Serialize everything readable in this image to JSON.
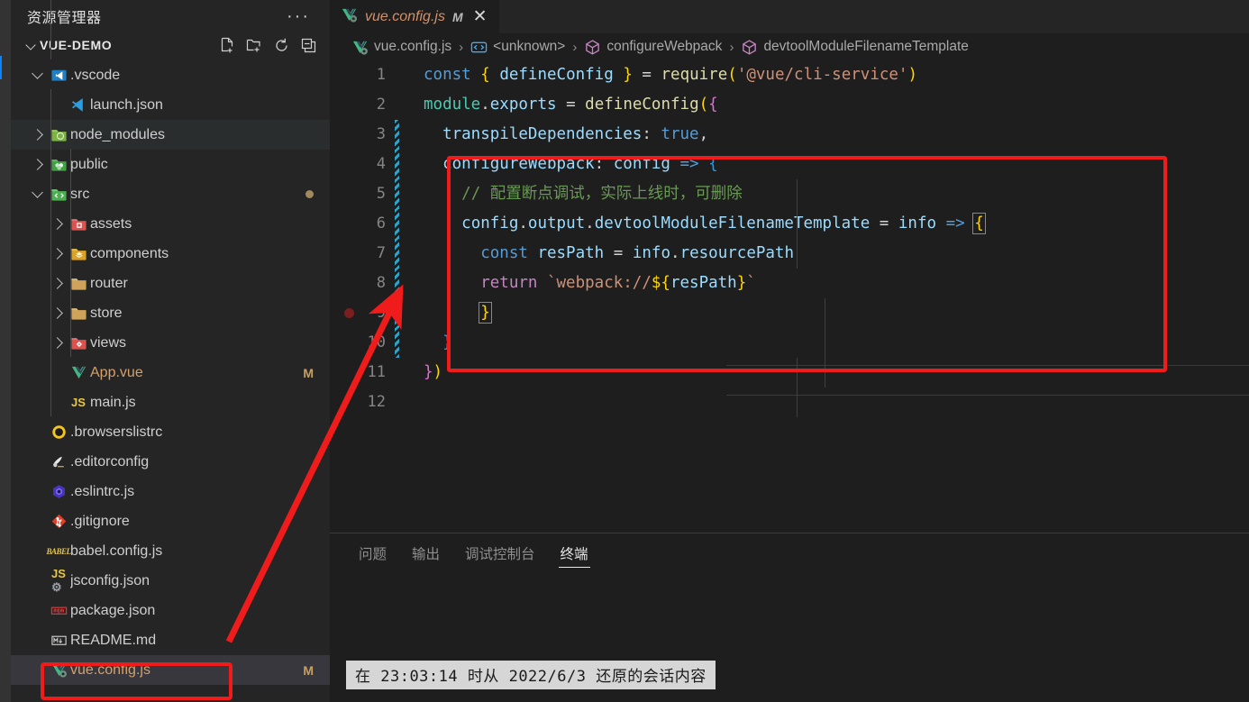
{
  "sidebar": {
    "title": "资源管理器",
    "more_label": "···",
    "project": {
      "label": "VUE-DEMO",
      "actions": [
        "new-file",
        "new-folder",
        "refresh",
        "collapse-all"
      ]
    },
    "items": [
      {
        "label": ".vscode",
        "icon": "vscode-folder-icon",
        "depth": 1,
        "twisty": "open",
        "badge": "",
        "dot": false,
        "selected": false,
        "hover": false
      },
      {
        "label": "launch.json",
        "icon": "vscode-file-icon",
        "depth": 2,
        "twisty": "none",
        "badge": "",
        "dot": false,
        "selected": false,
        "hover": false
      },
      {
        "label": "node_modules",
        "icon": "node-folder-icon",
        "depth": 1,
        "twisty": "closed",
        "badge": "",
        "dot": false,
        "selected": false,
        "hover": true
      },
      {
        "label": "public",
        "icon": "public-folder-icon",
        "depth": 1,
        "twisty": "closed",
        "badge": "",
        "dot": false,
        "selected": false,
        "hover": false
      },
      {
        "label": "src",
        "icon": "src-folder-icon",
        "depth": 1,
        "twisty": "open",
        "badge": "",
        "dot": true,
        "selected": false,
        "hover": false
      },
      {
        "label": "assets",
        "icon": "assets-folder-icon",
        "depth": 2,
        "twisty": "closed",
        "badge": "",
        "dot": false,
        "selected": false,
        "hover": false
      },
      {
        "label": "components",
        "icon": "components-folder-icon",
        "depth": 2,
        "twisty": "closed",
        "badge": "",
        "dot": false,
        "selected": false,
        "hover": false
      },
      {
        "label": "router",
        "icon": "folder-icon",
        "depth": 2,
        "twisty": "closed",
        "badge": "",
        "dot": false,
        "selected": false,
        "hover": false
      },
      {
        "label": "store",
        "icon": "folder-icon",
        "depth": 2,
        "twisty": "closed",
        "badge": "",
        "dot": false,
        "selected": false,
        "hover": false
      },
      {
        "label": "views",
        "icon": "views-folder-icon",
        "depth": 2,
        "twisty": "closed",
        "badge": "",
        "dot": false,
        "selected": false,
        "hover": false
      },
      {
        "label": "App.vue",
        "icon": "vue-file-icon",
        "depth": 2,
        "twisty": "none",
        "badge": "M",
        "dot": false,
        "selected": false,
        "hover": false
      },
      {
        "label": "main.js",
        "icon": "js-file-icon",
        "depth": 2,
        "twisty": "none",
        "badge": "",
        "dot": false,
        "selected": false,
        "hover": false
      },
      {
        "label": ".browserslistrc",
        "icon": "browserslist-icon",
        "depth": 1,
        "twisty": "none",
        "badge": "",
        "dot": false,
        "selected": false,
        "hover": false
      },
      {
        "label": ".editorconfig",
        "icon": "editorconfig-icon",
        "depth": 1,
        "twisty": "none",
        "badge": "",
        "dot": false,
        "selected": false,
        "hover": false
      },
      {
        "label": ".eslintrc.js",
        "icon": "eslint-icon",
        "depth": 1,
        "twisty": "none",
        "badge": "",
        "dot": false,
        "selected": false,
        "hover": false
      },
      {
        "label": ".gitignore",
        "icon": "git-icon",
        "depth": 1,
        "twisty": "none",
        "badge": "",
        "dot": false,
        "selected": false,
        "hover": false
      },
      {
        "label": "babel.config.js",
        "icon": "babel-icon",
        "depth": 1,
        "twisty": "none",
        "badge": "",
        "dot": false,
        "selected": false,
        "hover": false
      },
      {
        "label": "jsconfig.json",
        "icon": "jsconfig-icon",
        "depth": 1,
        "twisty": "none",
        "badge": "",
        "dot": false,
        "selected": false,
        "hover": false
      },
      {
        "label": "package.json",
        "icon": "npm-icon",
        "depth": 1,
        "twisty": "none",
        "badge": "",
        "dot": false,
        "selected": false,
        "hover": false
      },
      {
        "label": "README.md",
        "icon": "markdown-icon",
        "depth": 1,
        "twisty": "none",
        "badge": "",
        "dot": false,
        "selected": false,
        "hover": false
      },
      {
        "label": "vue.config.js",
        "icon": "vue-config-icon",
        "depth": 1,
        "twisty": "none",
        "badge": "M",
        "dot": false,
        "selected": true,
        "hover": false
      }
    ]
  },
  "tab": {
    "name": "vue.config.js",
    "modified_badge": "M",
    "close_label": "✕",
    "icon": "vue-config-icon"
  },
  "breadcrumbs": [
    {
      "text": "vue.config.js",
      "icon": "vue-config-icon"
    },
    {
      "text": "<unknown>",
      "icon": "symbol-namespace-icon"
    },
    {
      "text": "configureWebpack",
      "icon": "symbol-object-icon"
    },
    {
      "text": "devtoolModuleFilenameTemplate",
      "icon": "symbol-object-icon"
    }
  ],
  "editor": {
    "lines": [
      {
        "n": "1",
        "breakpoint": false,
        "changed": false
      },
      {
        "n": "2",
        "breakpoint": false,
        "changed": false
      },
      {
        "n": "3",
        "breakpoint": false,
        "changed": true
      },
      {
        "n": "4",
        "breakpoint": false,
        "changed": true
      },
      {
        "n": "5",
        "breakpoint": false,
        "changed": true
      },
      {
        "n": "6",
        "breakpoint": false,
        "changed": true
      },
      {
        "n": "7",
        "breakpoint": false,
        "changed": true
      },
      {
        "n": "8",
        "breakpoint": false,
        "changed": true
      },
      {
        "n": "9",
        "breakpoint": true,
        "changed": true
      },
      {
        "n": "10",
        "breakpoint": false,
        "changed": true
      },
      {
        "n": "11",
        "breakpoint": false,
        "changed": false
      },
      {
        "n": "12",
        "breakpoint": false,
        "changed": false
      }
    ],
    "code_plain": [
      "const { defineConfig } = require('@vue/cli-service')",
      "module.exports = defineConfig({",
      "  transpileDependencies: true,",
      "  configureWebpack: config => {",
      "    // 配置断点调试，实际上线时，可删除",
      "    config.output.devtoolModuleFilenameTemplate = info => {",
      "      const resPath = info.resourcePath",
      "      return `webpack://${resPath}`",
      "    }",
      "  }",
      "})",
      ""
    ]
  },
  "panel": {
    "tabs": [
      {
        "label": "问题",
        "active": false
      },
      {
        "label": "输出",
        "active": false
      },
      {
        "label": "调试控制台",
        "active": false
      },
      {
        "label": "终端",
        "active": true
      }
    ],
    "terminal_restore_line": "在 23:03:14 时从 2022/6/3 还原的会话内容"
  },
  "annotations": {
    "highlight_color": "#f01c1c",
    "arrow_color": "#f01c1c",
    "code_box_label": "configureWebpack-block-highlight",
    "file_box_label": "vue-config-js-file-highlight",
    "arrow_label": "pointer-from-file-to-code"
  }
}
